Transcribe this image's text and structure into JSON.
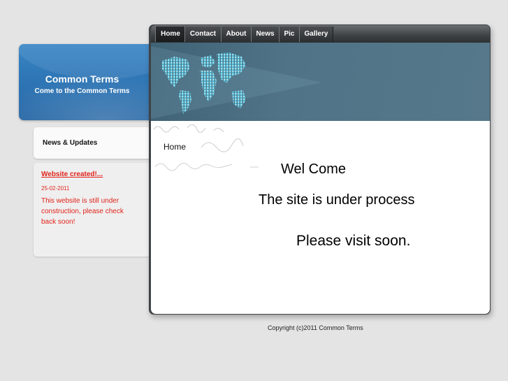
{
  "brand": {
    "title": "Common Terms",
    "subtitle": "Come to the Common Terms",
    "color": "#2e76b6"
  },
  "nav": {
    "items": [
      {
        "label": "Home",
        "active": true
      },
      {
        "label": "Contact",
        "active": false
      },
      {
        "label": "About",
        "active": false
      },
      {
        "label": "News",
        "active": false
      },
      {
        "label": "Pic",
        "active": false
      },
      {
        "label": "Gallery",
        "active": false
      }
    ]
  },
  "banner": {
    "icon": "world-map-icon"
  },
  "sidebar": {
    "heading": "News & Updates",
    "post": {
      "title": "Website created!...",
      "date": "25-02-2011",
      "text": "This website is still under construction, please check back soon!",
      "color": "#e0231a"
    }
  },
  "main": {
    "breadcrumb": "Home",
    "welcome": "Wel Come",
    "status": "The site is under process",
    "visit": "Please visit soon."
  },
  "footer": {
    "copyright": "Copyright (c)2011 Common Terms"
  }
}
